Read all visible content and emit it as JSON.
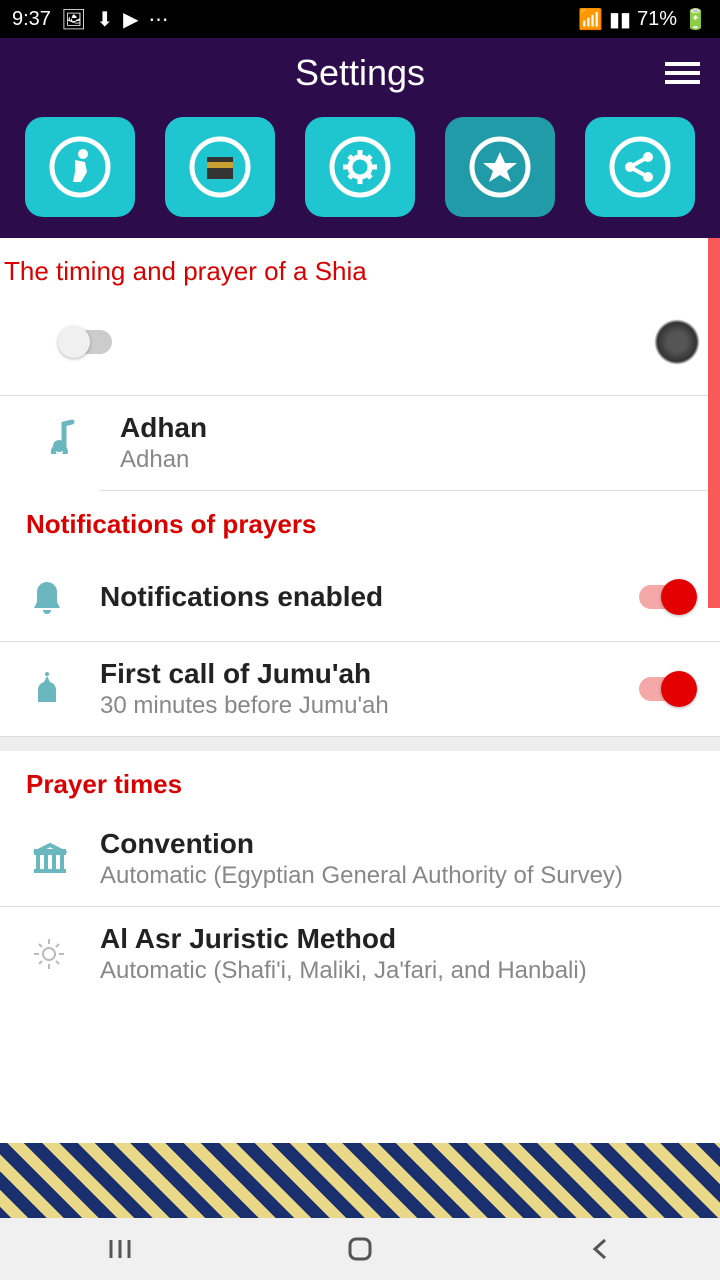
{
  "status": {
    "time": "9:37",
    "battery": "71%"
  },
  "header": {
    "title": "Settings"
  },
  "sections": {
    "shia": {
      "title": "The timing and prayer of a Shia",
      "adhan_label": "Adhan",
      "adhan_value": "Adhan"
    },
    "notifications": {
      "title": "Notifications of prayers",
      "enabled_label": "Notifications enabled",
      "jumuah_label": "First call of Jumu'ah",
      "jumuah_subtitle": "30 minutes before Jumu'ah"
    },
    "prayer_times": {
      "title": "Prayer times",
      "convention_label": "Convention",
      "convention_value": "Automatic (Egyptian General Authority of Survey)",
      "asr_label": "Al Asr Juristic Method",
      "asr_value": "Automatic (Shafi'i, Maliki, Ja'fari, and Hanbali)"
    }
  }
}
